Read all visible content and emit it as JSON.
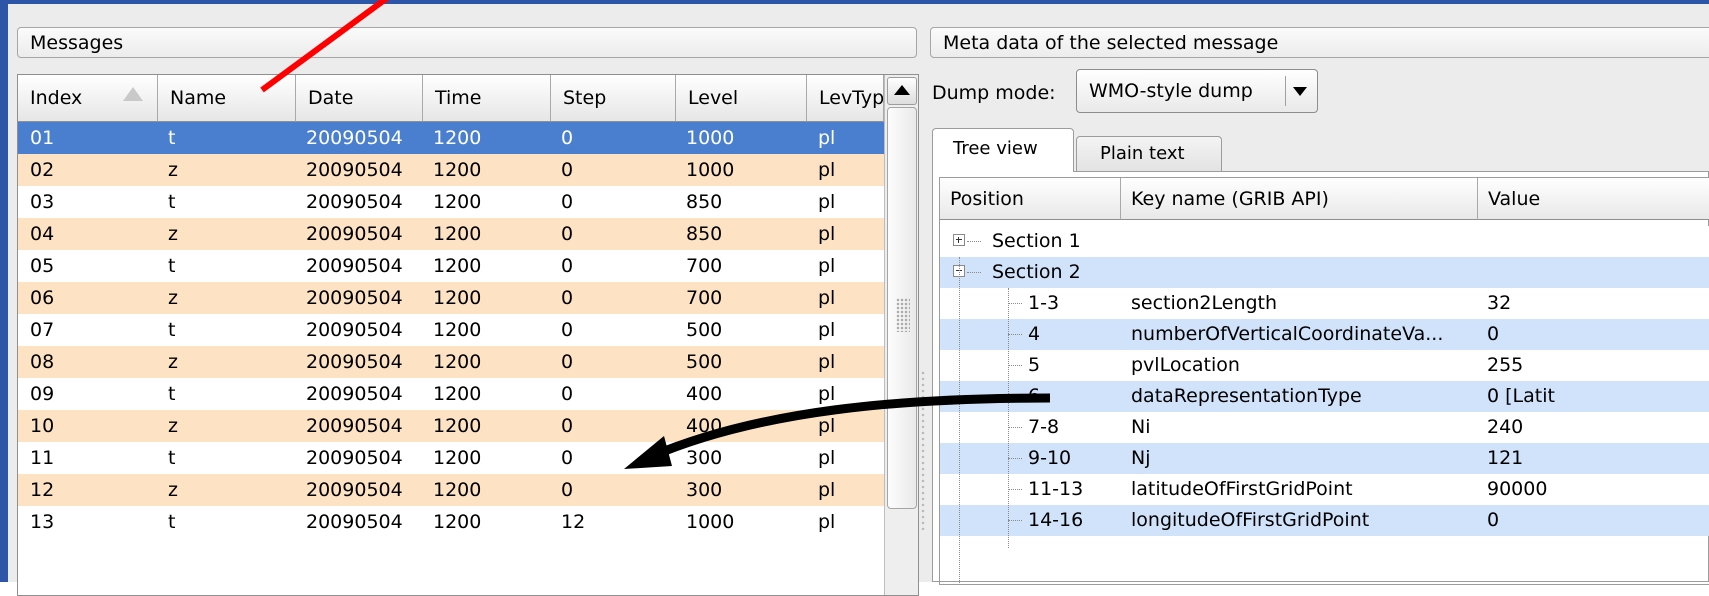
{
  "left_panel": {
    "header": "Messages",
    "columns": [
      "Index",
      "Name",
      "Date",
      "Time",
      "Step",
      "Level",
      "LevTyp"
    ],
    "rows": [
      {
        "index": "01",
        "name": "t",
        "date": "20090504",
        "time": "1200",
        "step": "0",
        "level": "1000",
        "levtype": "pl"
      },
      {
        "index": "02",
        "name": "z",
        "date": "20090504",
        "time": "1200",
        "step": "0",
        "level": "1000",
        "levtype": "pl"
      },
      {
        "index": "03",
        "name": "t",
        "date": "20090504",
        "time": "1200",
        "step": "0",
        "level": "850",
        "levtype": "pl"
      },
      {
        "index": "04",
        "name": "z",
        "date": "20090504",
        "time": "1200",
        "step": "0",
        "level": "850",
        "levtype": "pl"
      },
      {
        "index": "05",
        "name": "t",
        "date": "20090504",
        "time": "1200",
        "step": "0",
        "level": "700",
        "levtype": "pl"
      },
      {
        "index": "06",
        "name": "z",
        "date": "20090504",
        "time": "1200",
        "step": "0",
        "level": "700",
        "levtype": "pl"
      },
      {
        "index": "07",
        "name": "t",
        "date": "20090504",
        "time": "1200",
        "step": "0",
        "level": "500",
        "levtype": "pl"
      },
      {
        "index": "08",
        "name": "z",
        "date": "20090504",
        "time": "1200",
        "step": "0",
        "level": "500",
        "levtype": "pl"
      },
      {
        "index": "09",
        "name": "t",
        "date": "20090504",
        "time": "1200",
        "step": "0",
        "level": "400",
        "levtype": "pl"
      },
      {
        "index": "10",
        "name": "z",
        "date": "20090504",
        "time": "1200",
        "step": "0",
        "level": "400",
        "levtype": "pl"
      },
      {
        "index": "11",
        "name": "t",
        "date": "20090504",
        "time": "1200",
        "step": "0",
        "level": "300",
        "levtype": "pl"
      },
      {
        "index": "12",
        "name": "z",
        "date": "20090504",
        "time": "1200",
        "step": "0",
        "level": "300",
        "levtype": "pl"
      },
      {
        "index": "13",
        "name": "t",
        "date": "20090504",
        "time": "1200",
        "step": "12",
        "level": "1000",
        "levtype": "pl"
      }
    ],
    "selected_index": "01"
  },
  "right_panel": {
    "header": "Meta data of the selected message",
    "dump_mode_label": "Dump mode:",
    "dump_mode_value": "WMO-style dump",
    "tabs": [
      "Tree view",
      "Plain text"
    ],
    "active_tab": "Tree view",
    "tree_columns": [
      "Position",
      "Key name (GRIB API)",
      "Value"
    ],
    "sections": [
      {
        "label": "Section 1",
        "expanded": false
      },
      {
        "label": "Section 2",
        "expanded": true
      }
    ],
    "entries": [
      {
        "position": "1-3",
        "key": "section2Length",
        "value": "32"
      },
      {
        "position": "4",
        "key": "numberOfVerticalCoordinateVa...",
        "value": "0"
      },
      {
        "position": "5",
        "key": "pvlLocation",
        "value": "255"
      },
      {
        "position": "6",
        "key": "dataRepresentationType",
        "value": "0 [Latit"
      },
      {
        "position": "7-8",
        "key": "Ni",
        "value": "240"
      },
      {
        "position": "9-10",
        "key": "Nj",
        "value": "121"
      },
      {
        "position": "11-13",
        "key": "latitudeOfFirstGridPoint",
        "value": "90000"
      },
      {
        "position": "14-16",
        "key": "longitudeOfFirstGridPoint",
        "value": "0"
      }
    ]
  },
  "colors": {
    "selection": "#4a7fd0",
    "even_row": "#fde3c3",
    "tree_row_alt": "#d1e3fb",
    "annotation_red": "#ff0000",
    "annotation_black": "#000000"
  }
}
